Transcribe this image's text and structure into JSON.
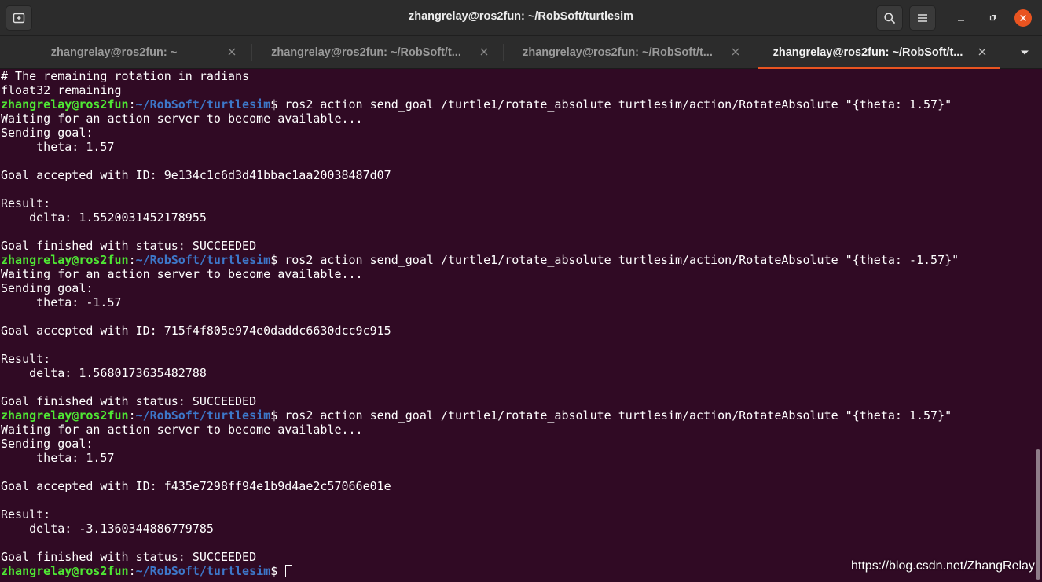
{
  "window": {
    "title": "zhangrelay@ros2fun: ~/RobSoft/turtlesim",
    "controls": {
      "new_tab_icon": "new-tab-icon",
      "search_icon": "search-icon",
      "menu_icon": "hamburger-menu-icon"
    }
  },
  "colors": {
    "background": "#300a24",
    "prompt_user": "#4fe834",
    "prompt_path": "#3d77c9",
    "accent": "#e95420",
    "text": "#ffffff"
  },
  "tabs": [
    {
      "label": "zhangrelay@ros2fun: ~",
      "active": false
    },
    {
      "label": "zhangrelay@ros2fun: ~/RobSoft/t...",
      "active": false
    },
    {
      "label": "zhangrelay@ros2fun: ~/RobSoft/t...",
      "active": false
    },
    {
      "label": "zhangrelay@ros2fun: ~/RobSoft/t...",
      "active": true
    }
  ],
  "terminal": {
    "lines": [
      {
        "text": "# The remaining rotation in radians"
      },
      {
        "text": "float32 remaining"
      },
      {
        "prompt": {
          "user": "zhangrelay@ros2fun",
          "path": "~/RobSoft/turtlesim"
        },
        "command": " ros2 action send_goal /turtle1/rotate_absolute turtlesim/action/RotateAbsolute \"{theta: 1.57}\""
      },
      {
        "text": "Waiting for an action server to become available..."
      },
      {
        "text": "Sending goal:"
      },
      {
        "text": "     theta: 1.57"
      },
      {
        "text": ""
      },
      {
        "text": "Goal accepted with ID: 9e134c1c6d3d41bbac1aa20038487d07"
      },
      {
        "text": ""
      },
      {
        "text": "Result:"
      },
      {
        "text": "    delta: 1.5520031452178955"
      },
      {
        "text": ""
      },
      {
        "text": "Goal finished with status: SUCCEEDED"
      },
      {
        "prompt": {
          "user": "zhangrelay@ros2fun",
          "path": "~/RobSoft/turtlesim"
        },
        "command": " ros2 action send_goal /turtle1/rotate_absolute turtlesim/action/RotateAbsolute \"{theta: -1.57}\""
      },
      {
        "text": "Waiting for an action server to become available..."
      },
      {
        "text": "Sending goal:"
      },
      {
        "text": "     theta: -1.57"
      },
      {
        "text": ""
      },
      {
        "text": "Goal accepted with ID: 715f4f805e974e0daddc6630dcc9c915"
      },
      {
        "text": ""
      },
      {
        "text": "Result:"
      },
      {
        "text": "    delta: 1.5680173635482788"
      },
      {
        "text": ""
      },
      {
        "text": "Goal finished with status: SUCCEEDED"
      },
      {
        "prompt": {
          "user": "zhangrelay@ros2fun",
          "path": "~/RobSoft/turtlesim"
        },
        "command": " ros2 action send_goal /turtle1/rotate_absolute turtlesim/action/RotateAbsolute \"{theta: 1.57}\""
      },
      {
        "text": "Waiting for an action server to become available..."
      },
      {
        "text": "Sending goal:"
      },
      {
        "text": "     theta: 1.57"
      },
      {
        "text": ""
      },
      {
        "text": "Goal accepted with ID: f435e7298ff94e1b9d4ae2c57066e01e"
      },
      {
        "text": ""
      },
      {
        "text": "Result:"
      },
      {
        "text": "    delta: -3.1360344886779785"
      },
      {
        "text": ""
      },
      {
        "text": "Goal finished with status: SUCCEEDED"
      },
      {
        "prompt": {
          "user": "zhangrelay@ros2fun",
          "path": "~/RobSoft/turtlesim"
        },
        "command": " ",
        "cursor": true
      }
    ]
  },
  "watermark": "https://blog.csdn.net/ZhangRelay"
}
